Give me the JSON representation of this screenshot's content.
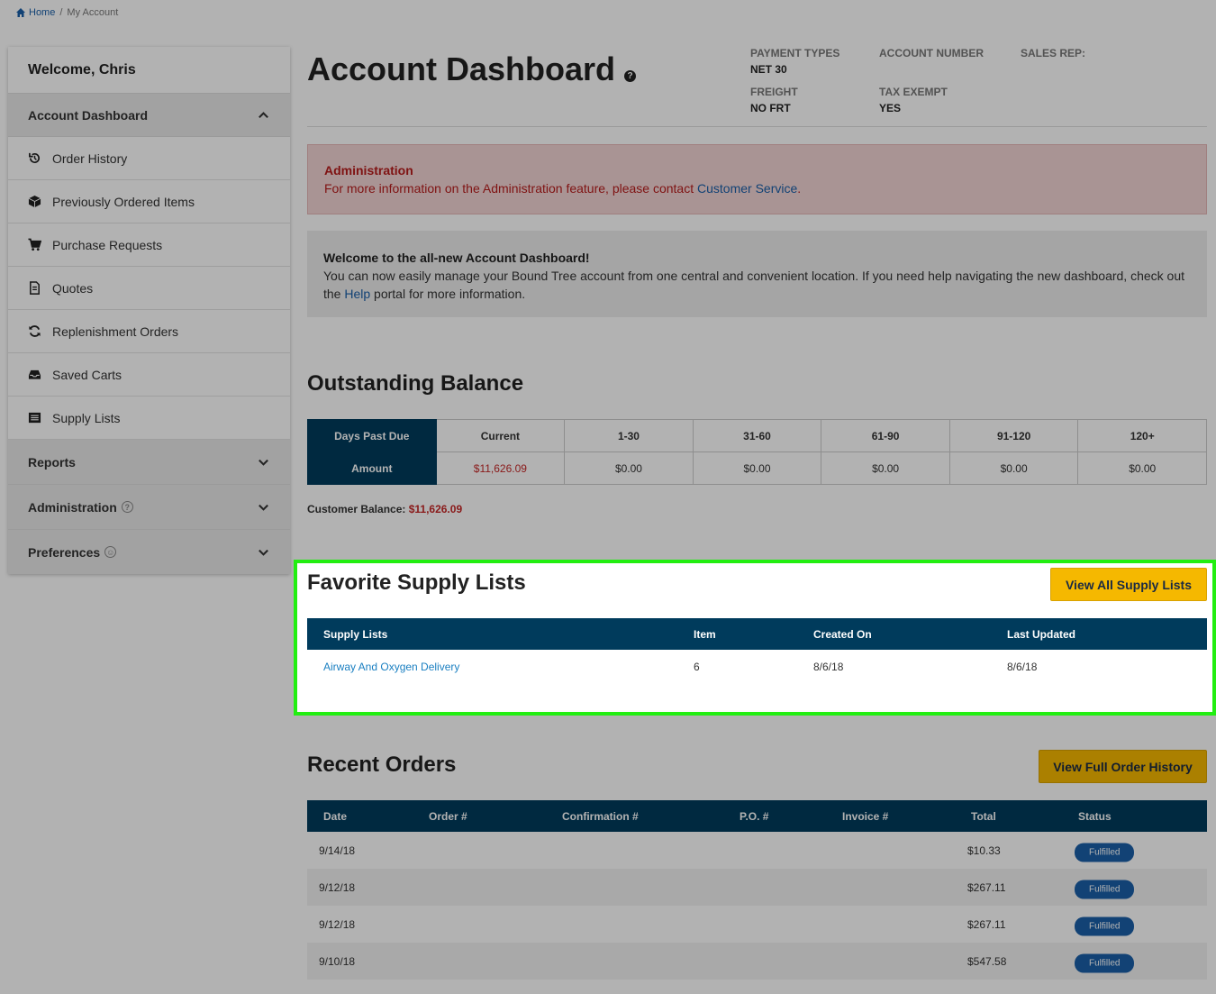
{
  "breadcrumb": {
    "home": "Home",
    "separator": "/",
    "current": "My Account"
  },
  "sidebar": {
    "welcome": "Welcome, Chris",
    "dashboard_label": "Account Dashboard",
    "items": [
      {
        "label": "Order History",
        "icon": "history-icon"
      },
      {
        "label": "Previously Ordered Items",
        "icon": "box-icon"
      },
      {
        "label": "Purchase Requests",
        "icon": "cart-icon"
      },
      {
        "label": "Quotes",
        "icon": "document-icon"
      },
      {
        "label": "Replenishment Orders",
        "icon": "refresh-icon"
      },
      {
        "label": "Saved Carts",
        "icon": "inbox-icon"
      },
      {
        "label": "Supply Lists",
        "icon": "list-icon"
      }
    ],
    "sections": [
      {
        "label": "Reports"
      },
      {
        "label": "Administration"
      },
      {
        "label": "Preferences"
      }
    ]
  },
  "header": {
    "title": "Account Dashboard",
    "meta": {
      "payment_types_label": "PAYMENT TYPES",
      "payment_types_value": "NET 30",
      "account_number_label": "ACCOUNT NUMBER",
      "sales_rep_label": "SALES REP:",
      "freight_label": "FREIGHT",
      "freight_value": "NO FRT",
      "tax_exempt_label": "TAX EXEMPT",
      "tax_exempt_value": "YES"
    }
  },
  "alerts": {
    "admin_title": "Administration",
    "admin_text": "For more information on the Administration feature, please contact",
    "admin_link": "Customer Service",
    "admin_end": ".",
    "welcome_title": "Welcome to the all-new Account Dashboard!",
    "welcome_text": "You can now easily manage your Bound Tree account from one central and convenient location. If you need help navigating the new dashboard, check out the",
    "welcome_link": "Help",
    "welcome_end": "portal for more information."
  },
  "balance": {
    "title": "Outstanding Balance",
    "row_header_days": "Days Past Due",
    "row_header_amount": "Amount",
    "columns": [
      "Current",
      "1-30",
      "31-60",
      "61-90",
      "91-120",
      "120+"
    ],
    "amounts": [
      "$11,626.09",
      "$0.00",
      "$0.00",
      "$0.00",
      "$0.00",
      "$0.00"
    ],
    "customer_balance_label": "Customer Balance:",
    "customer_balance_value": "$11,626.09"
  },
  "supply_lists": {
    "title": "Favorite Supply Lists",
    "button": "View All Supply Lists",
    "headers": [
      "Supply Lists",
      "Item",
      "Created On",
      "Last Updated"
    ],
    "rows": [
      {
        "name": "Airway And Oxygen Delivery",
        "item": "6",
        "created": "8/6/18",
        "updated": "8/6/18"
      }
    ]
  },
  "orders": {
    "title": "Recent Orders",
    "button": "View Full Order History",
    "headers": [
      "Date",
      "Order #",
      "Confirmation #",
      "P.O. #",
      "Invoice #",
      "Total",
      "Status"
    ],
    "rows": [
      {
        "date": "9/14/18",
        "total": "$10.33",
        "status": "Fulfilled"
      },
      {
        "date": "9/12/18",
        "total": "$267.11",
        "status": "Fulfilled"
      },
      {
        "date": "9/12/18",
        "total": "$267.11",
        "status": "Fulfilled"
      },
      {
        "date": "9/10/18",
        "total": "$547.58",
        "status": "Fulfilled"
      }
    ]
  },
  "colors": {
    "navy": "#003b5c",
    "accent_yellow": "#f5b800",
    "link": "#1a5fa8",
    "highlight": "#22ee11",
    "error_red": "#c62828"
  }
}
